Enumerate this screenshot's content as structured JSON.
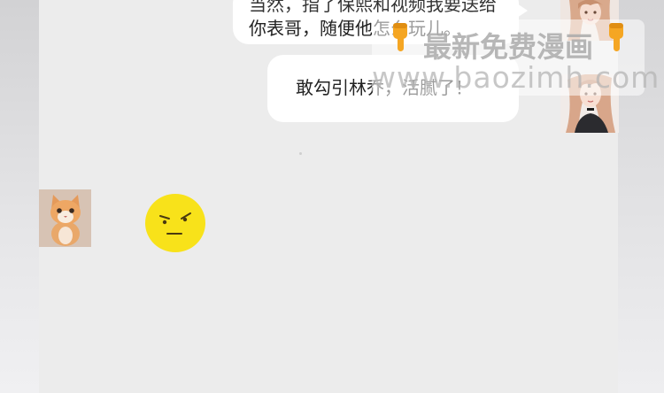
{
  "chat": {
    "messages": [
      {
        "sender": "girl",
        "side": "right",
        "lines": [
          "当然，指了保熙和视频我要送给",
          "你表哥，随便他怎么玩儿。"
        ]
      },
      {
        "sender": "girl",
        "side": "right",
        "lines": [
          "敢勾引林乔，活腻了！"
        ]
      },
      {
        "sender": "cat",
        "side": "left",
        "sticker": "annoyed-face-emoji"
      }
    ]
  },
  "watermark": {
    "title": "最新免费漫画",
    "url": "www.baozimh.com",
    "icon": "pointing-down-hand-icon"
  },
  "colors": {
    "panel": "#ececec",
    "bubble": "#ffffff",
    "emoji": "#f8e21a"
  }
}
